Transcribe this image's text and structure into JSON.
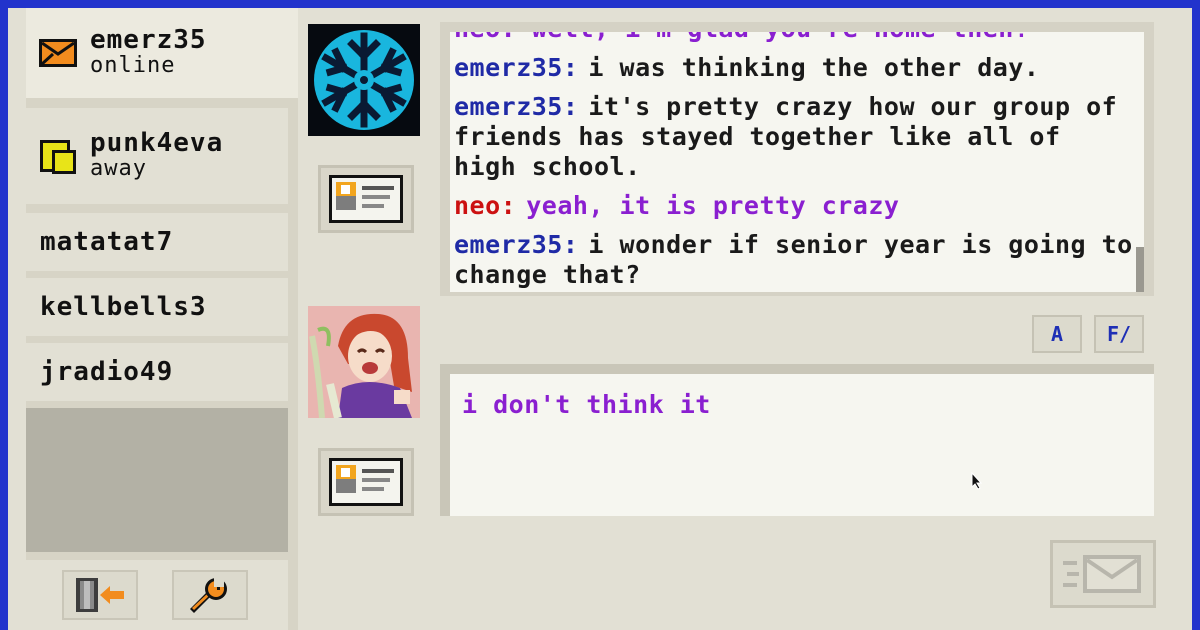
{
  "contacts": [
    {
      "name": "emerz35",
      "status": "online",
      "icon": "envelope-icon"
    },
    {
      "name": "punk4eva",
      "status": "away",
      "icon": "sticky-note-icon"
    },
    {
      "name": "matatat7"
    },
    {
      "name": "kellbells3"
    },
    {
      "name": "jradio49"
    }
  ],
  "sidebar_buttons": [
    {
      "icon": "sign-out-door-icon"
    },
    {
      "icon": "wrench-settings-icon"
    }
  ],
  "chat": {
    "partial_line": "neo: well, i'm glad you're home then!",
    "messages": [
      {
        "sender": "emerz35:",
        "text": "i was thinking the other day."
      },
      {
        "sender": "emerz35:",
        "text": "it's pretty crazy how our group of friends has stayed together like all of high school."
      },
      {
        "sender": "neo:",
        "text": "yeah, it is pretty crazy"
      },
      {
        "sender": "emerz35:",
        "text": "i wonder if senior year is going to change that?"
      }
    ]
  },
  "format_buttons": [
    {
      "label": "A"
    },
    {
      "label": "F/"
    }
  ],
  "input": {
    "value": "i don't think it"
  },
  "colors": {
    "frame": "#2233cc",
    "sender_emerz": "#1f2aa6",
    "sender_neo": "#cc1111",
    "text_neo": "#8a1fd0"
  }
}
